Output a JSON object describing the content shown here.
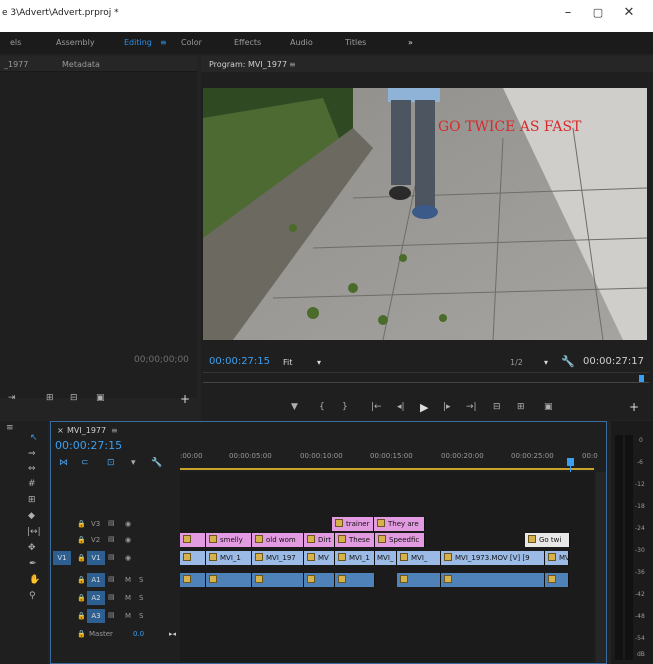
{
  "title_bar": {
    "title": "e 3\\Advert\\Advert.prproj *",
    "min": "–",
    "max": "▢",
    "close": "✕"
  },
  "workspaces": [
    {
      "label": "els",
      "active": false
    },
    {
      "label": "Assembly",
      "active": false
    },
    {
      "label": "Editing",
      "active": true
    },
    {
      "label": "≡",
      "active": true
    },
    {
      "label": "Color",
      "active": false
    },
    {
      "label": "Effects",
      "active": false
    },
    {
      "label": "Audio",
      "active": false
    },
    {
      "label": "Titles",
      "active": false
    },
    {
      "label": "»",
      "active": false
    }
  ],
  "source_panel": {
    "tab1": "_1977",
    "tab2": "Metadata",
    "timecode": "00;00;00;00"
  },
  "program": {
    "title": "Program: MVI_1977",
    "menu": "≡",
    "overlay_text": "GO TWICE AS FAST",
    "timecode": "00:00:27:15",
    "fit": "Fit",
    "res": "1/2",
    "duration": "00:00:27:17"
  },
  "timeline": {
    "tab": "MVI_1977",
    "menu": "≡",
    "close": "×",
    "timecode": "00:00:27:15",
    "ruler": [
      ":00:00",
      "00:00:05:00",
      "00:00:10:00",
      "00:00:15:00",
      "00:00:20:00",
      "00:00:25:00",
      "00:0"
    ],
    "tracks": [
      {
        "lock": "🔒",
        "name": "V3",
        "eye": "👁"
      },
      {
        "lock": "🔒",
        "name": "V2",
        "eye": "👁"
      },
      {
        "src": "V1",
        "lock": "🔒",
        "name": "V1",
        "eye": "👁"
      },
      {
        "lock": "🔒",
        "name": "A1",
        "m": "M",
        "s": "S"
      },
      {
        "lock": "🔒",
        "name": "A2",
        "m": "M",
        "s": "S"
      },
      {
        "lock": "🔒",
        "name": "A3",
        "m": "M",
        "s": "S"
      }
    ],
    "master": {
      "label": "Master",
      "value": "0.0",
      "end": "▸◂"
    },
    "v3_clips": [
      "trainer",
      "They are"
    ],
    "v2_clips": [
      "",
      "smelly",
      "old wom",
      "Dirt",
      "These",
      "Speedfic",
      "Go twi"
    ],
    "v1_clips": [
      "",
      "MVI_1",
      "MVI_197",
      "MV",
      "MVI_1",
      "MVI_",
      "MVI_",
      "MVI_1973.MOV [V] [9",
      "MVI"
    ],
    "meter_scale": [
      "0",
      "-6",
      "-12",
      "-18",
      "-24",
      "-30",
      "-36",
      "-42",
      "-48",
      "-54",
      "dB"
    ]
  }
}
